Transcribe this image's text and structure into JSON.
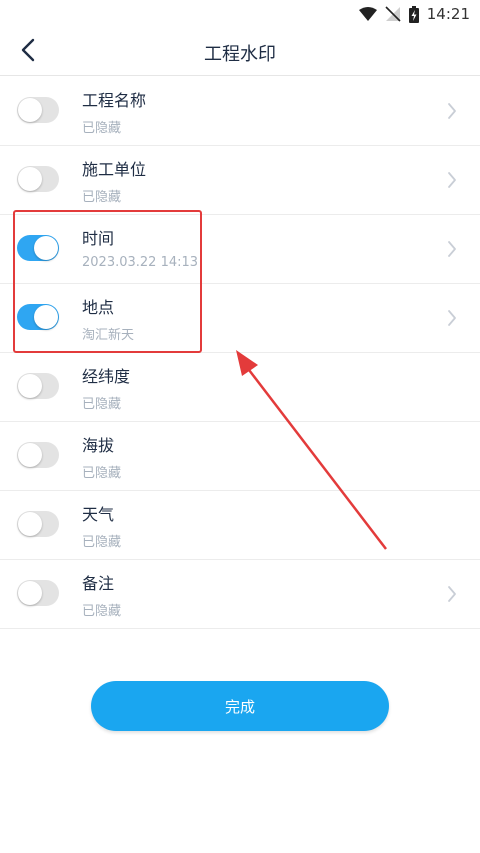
{
  "status_bar": {
    "time": "14:21"
  },
  "header": {
    "title": "工程水印"
  },
  "items": [
    {
      "title": "工程名称",
      "subtitle": "已隐藏",
      "enabled": false,
      "has_arrow": true
    },
    {
      "title": "施工单位",
      "subtitle": "已隐藏",
      "enabled": false,
      "has_arrow": true
    },
    {
      "title": "时间",
      "subtitle": "2023.03.22 14:13",
      "enabled": true,
      "has_arrow": true
    },
    {
      "title": "地点",
      "subtitle": "淘汇新天",
      "enabled": true,
      "has_arrow": true
    },
    {
      "title": "经纬度",
      "subtitle": "已隐藏",
      "enabled": false,
      "has_arrow": false
    },
    {
      "title": "海拔",
      "subtitle": "已隐藏",
      "enabled": false,
      "has_arrow": false
    },
    {
      "title": "天气",
      "subtitle": "已隐藏",
      "enabled": false,
      "has_arrow": false
    },
    {
      "title": "备注",
      "subtitle": "已隐藏",
      "enabled": false,
      "has_arrow": true
    }
  ],
  "done_button": {
    "label": "完成"
  },
  "colors": {
    "accent": "#1aa6f0",
    "toggle_on": "#2fa6f2",
    "annotation": "#e33b3b"
  },
  "icons": [
    "wifi-icon",
    "no-signal-icon",
    "battery-charging-icon",
    "back-arrow-icon",
    "chevron-right-icon"
  ]
}
